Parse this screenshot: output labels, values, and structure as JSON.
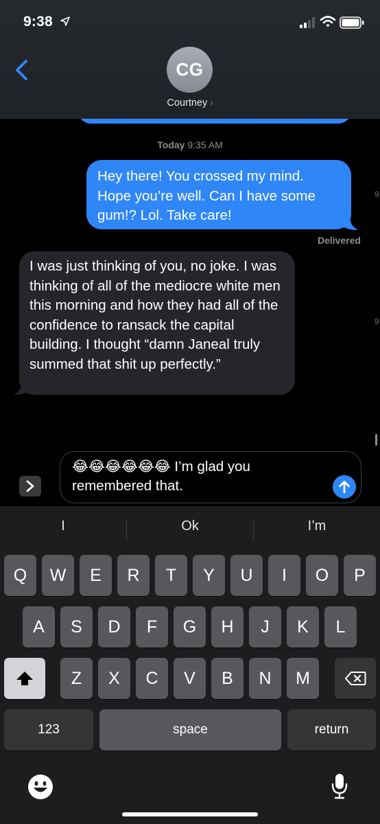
{
  "status_bar": {
    "time": "9:38"
  },
  "header": {
    "avatar_initials": "CG",
    "contact_name": "Courtney"
  },
  "conversation": {
    "timestamp_day": "Today",
    "timestamp_time": "9:35 AM",
    "sent_message": "Hey there! You crossed my mind. Hope you’re well. Can I have some gum!? Lol. Take care!",
    "delivered_label": "Delivered",
    "received_message": "I was just thinking of you, no joke. I was thinking of all of the mediocre white men this morning and how they had all of the confidence to ransack the capital building. I thought “damn Janeal truly summed that shit up perfectly.”",
    "edge_time_1": "9",
    "edge_time_2": "9"
  },
  "compose": {
    "emojis": "😂😂😂😂😂😂",
    "text": " I’m glad you remembered that."
  },
  "keyboard": {
    "predictions": [
      "I",
      "Ok",
      "I’m"
    ],
    "row1": [
      "Q",
      "W",
      "E",
      "R",
      "T",
      "Y",
      "U",
      "I",
      "O",
      "P"
    ],
    "row2": [
      "A",
      "S",
      "D",
      "F",
      "G",
      "H",
      "J",
      "K",
      "L"
    ],
    "row3": [
      "Z",
      "X",
      "C",
      "V",
      "B",
      "N",
      "M"
    ],
    "numbers_label": "123",
    "space_label": "space",
    "return_label": "return"
  },
  "colors": {
    "sent_bubble": "#2f86f7",
    "received_bubble": "#26262a",
    "keyboard_bg": "#1d1d1f"
  },
  "icons": [
    "location-arrow-icon",
    "signal-icon",
    "wifi-icon",
    "battery-icon",
    "back-chevron-icon",
    "expand-chevron-icon",
    "send-arrow-icon",
    "shift-icon",
    "backspace-icon",
    "emoji-icon",
    "microphone-icon"
  ]
}
